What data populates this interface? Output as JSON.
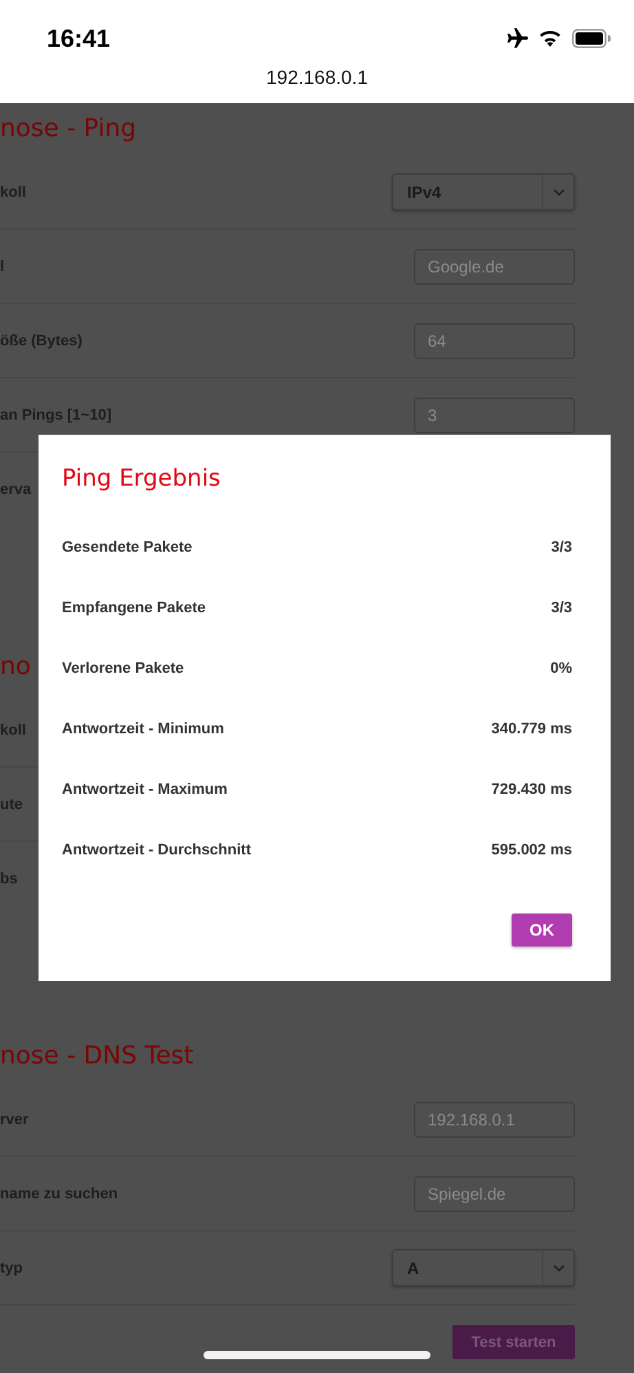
{
  "status_bar": {
    "time": "16:41"
  },
  "address_bar": {
    "url": "192.168.0.1"
  },
  "sections": [
    {
      "title": "nose - Ping",
      "rows": [
        {
          "label": "koll",
          "kind": "select",
          "value": "IPv4"
        },
        {
          "label": "l",
          "kind": "input",
          "placeholder": "Google.de"
        },
        {
          "label": "öße (Bytes)",
          "kind": "input",
          "placeholder": "64"
        },
        {
          "label": "an Pings [1~10]",
          "kind": "input",
          "placeholder": "3"
        },
        {
          "label": "erva",
          "kind": "text"
        }
      ]
    },
    {
      "title": "no",
      "rows": [
        {
          "label": "koll",
          "kind": "text"
        },
        {
          "label": "ute",
          "kind": "text"
        },
        {
          "label": "bs",
          "kind": "text"
        }
      ]
    },
    {
      "title": "nose - DNS Test",
      "rows": [
        {
          "label": "rver",
          "kind": "input",
          "placeholder": "192.168.0.1"
        },
        {
          "label": "name zu suchen",
          "kind": "input",
          "placeholder": "Spiegel.de"
        },
        {
          "label": "typ",
          "kind": "select",
          "value": "A"
        }
      ],
      "button": "Test starten"
    }
  ],
  "dialog": {
    "title": "Ping Ergebnis",
    "results": [
      {
        "label": "Gesendete Pakete",
        "value": "3/3"
      },
      {
        "label": "Empfangene Pakete",
        "value": "3/3"
      },
      {
        "label": "Verlorene Pakete",
        "value": "0%"
      },
      {
        "label": "Antwortzeit - Minimum",
        "value": "340.779 ms"
      },
      {
        "label": "Antwortzeit - Maximum",
        "value": "729.430 ms"
      },
      {
        "label": "Antwortzeit - Durchschnitt",
        "value": "595.002 ms"
      }
    ],
    "ok_button": "OK"
  }
}
